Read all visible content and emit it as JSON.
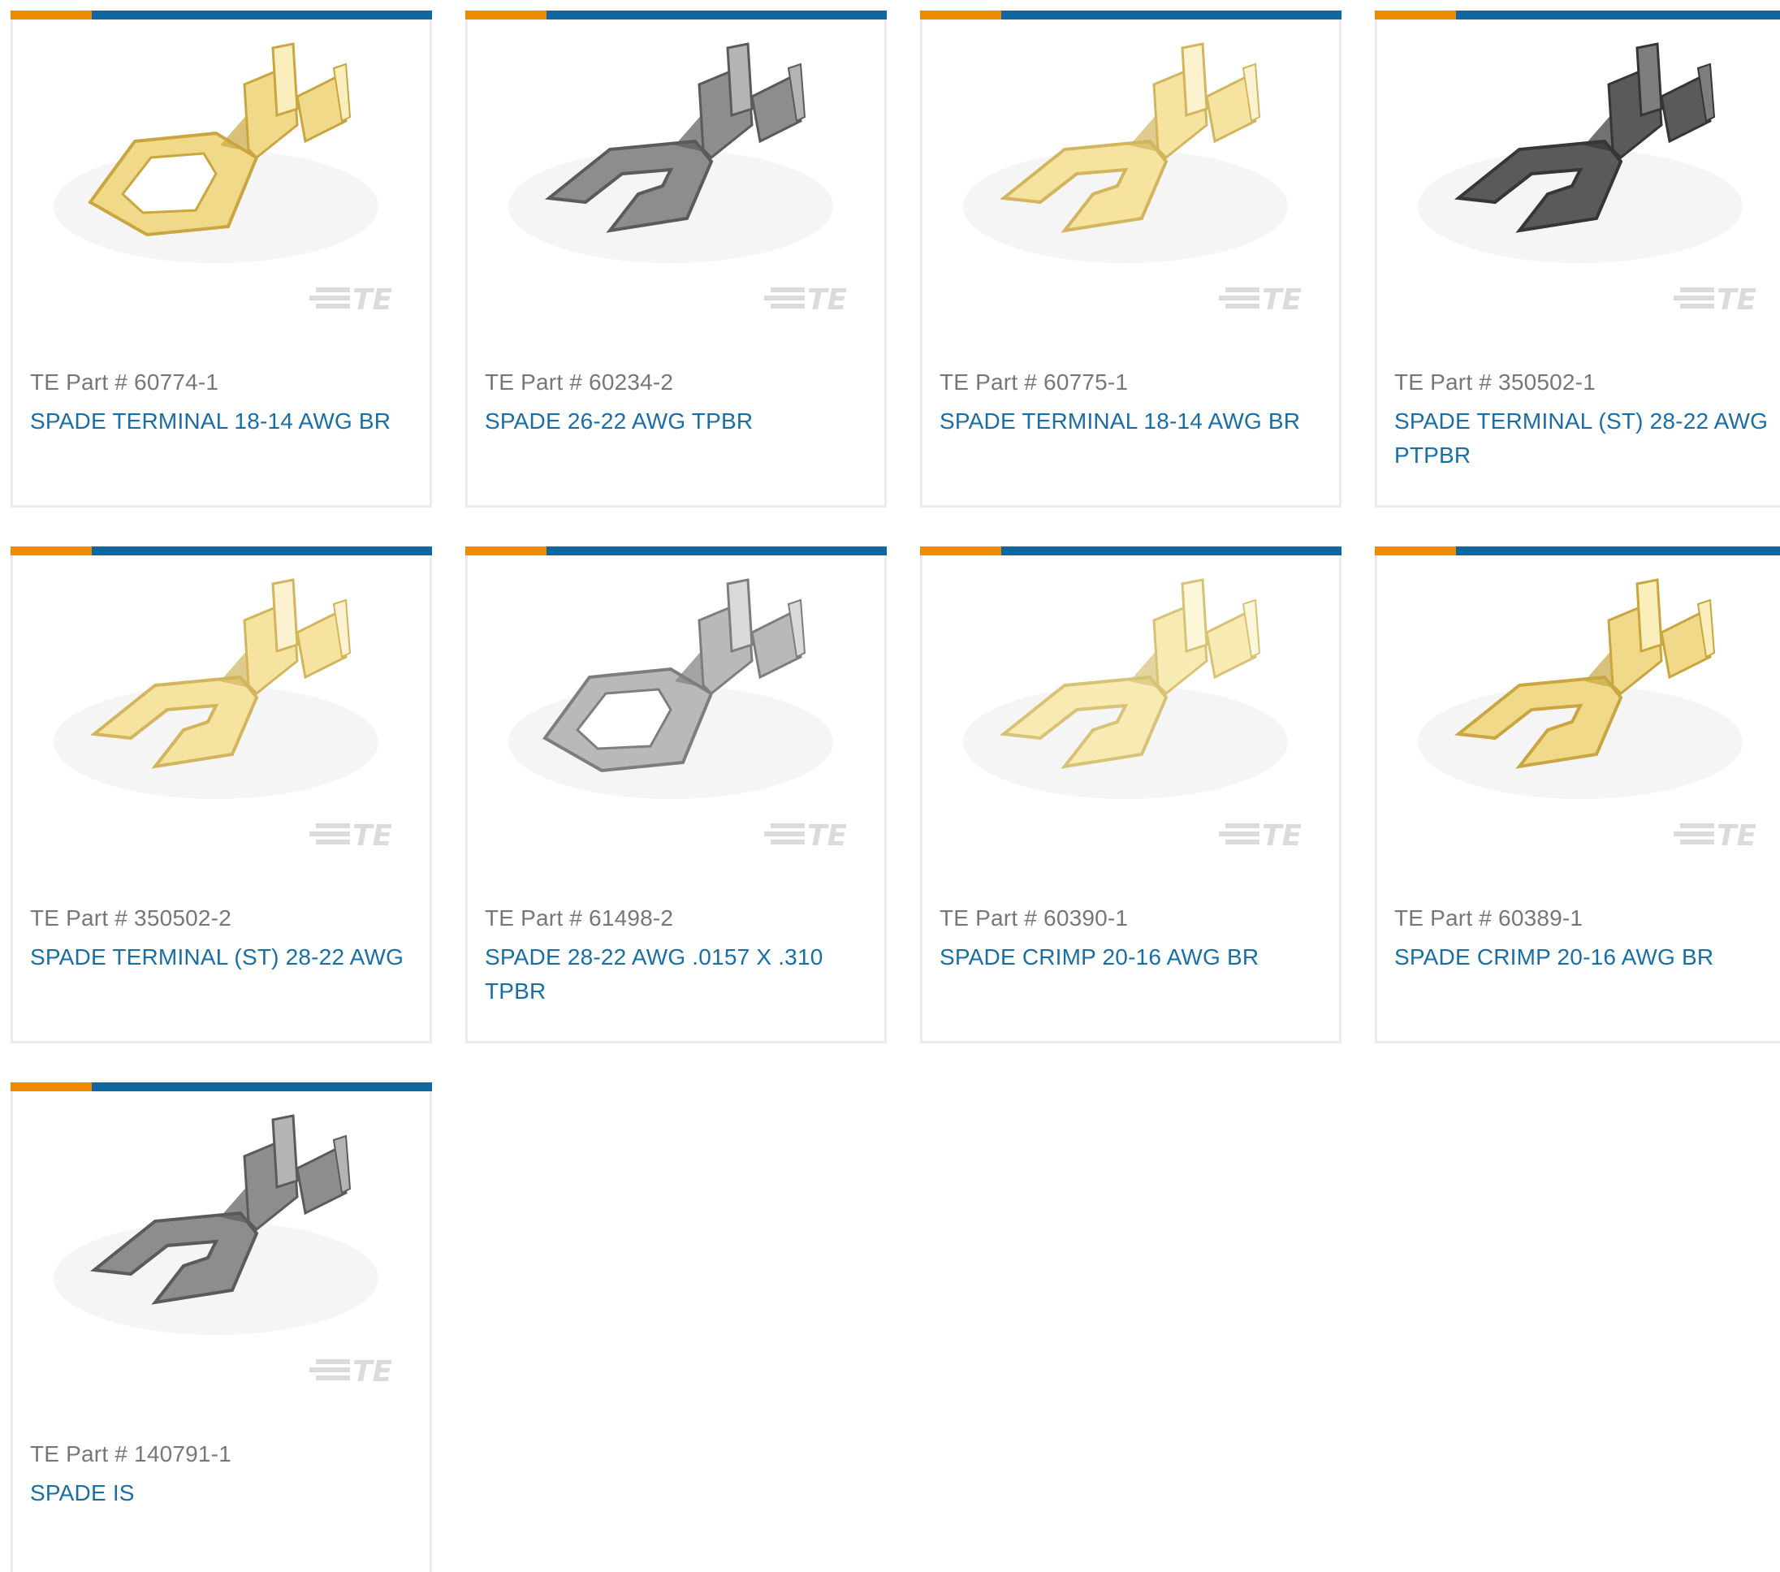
{
  "colors": {
    "accent_orange": "#f08a00",
    "accent_blue": "#0f67a2",
    "link_blue": "#1a6ea6",
    "part_gray": "#777777",
    "border_gray": "#ebebeb"
  },
  "products": [
    {
      "part_prefix": "TE Part #",
      "part_number": "60774-1",
      "part_label": "TE Part # 60774-1",
      "title": "SPADE TERMINAL 18-14 AWG BR",
      "finish": "gold",
      "shape": "ring",
      "image_icon": "spade-terminal-image",
      "watermark": "TE"
    },
    {
      "part_prefix": "TE Part #",
      "part_number": "60234-2",
      "part_label": "TE Part # 60234-2",
      "title": "SPADE 26-22 AWG TPBR",
      "finish": "gray",
      "shape": "fork",
      "image_icon": "spade-terminal-image",
      "watermark": "TE"
    },
    {
      "part_prefix": "TE Part #",
      "part_number": "60775-1",
      "part_label": "TE Part # 60775-1",
      "title": "SPADE TERMINAL 18-14 AWG BR",
      "finish": "lightgold",
      "shape": "fork",
      "image_icon": "spade-terminal-image",
      "watermark": "TE"
    },
    {
      "part_prefix": "TE Part #",
      "part_number": "350502-1",
      "part_label": "TE Part # 350502-1",
      "title": "SPADE TERMINAL (ST) 28-22 AWG PTPBR",
      "finish": "dark",
      "shape": "fork",
      "image_icon": "spade-terminal-image",
      "watermark": "TE"
    },
    {
      "part_prefix": "TE Part #",
      "part_number": "350502-2",
      "part_label": "TE Part # 350502-2",
      "title": "SPADE TERMINAL (ST) 28-22 AWG",
      "finish": "lightgold",
      "shape": "fork",
      "image_icon": "spade-terminal-image",
      "watermark": "TE"
    },
    {
      "part_prefix": "TE Part #",
      "part_number": "61498-2",
      "part_label": "TE Part # 61498-2",
      "title": "SPADE 28-22 AWG .0157 X .310 TPBR",
      "finish": "silver",
      "shape": "ring",
      "image_icon": "spade-terminal-image",
      "watermark": "TE"
    },
    {
      "part_prefix": "TE Part #",
      "part_number": "60390-1",
      "part_label": "TE Part # 60390-1",
      "title": "SPADE CRIMP 20-16 AWG BR",
      "finish": "palegold",
      "shape": "fork",
      "image_icon": "spade-terminal-image",
      "watermark": "TE"
    },
    {
      "part_prefix": "TE Part #",
      "part_number": "60389-1",
      "part_label": "TE Part # 60389-1",
      "title": "SPADE CRIMP 20-16 AWG BR",
      "finish": "gold",
      "shape": "fork",
      "image_icon": "spade-terminal-image",
      "watermark": "TE"
    },
    {
      "part_prefix": "TE Part #",
      "part_number": "140791-1",
      "part_label": "TE Part # 140791-1",
      "title": "SPADE IS",
      "finish": "gray",
      "shape": "fork",
      "image_icon": "spade-terminal-image",
      "watermark": "TE"
    }
  ]
}
